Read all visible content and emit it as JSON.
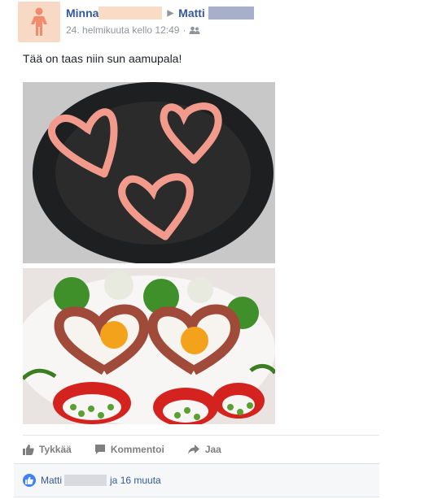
{
  "post": {
    "author": "Minna",
    "target": "Matti",
    "timestamp": "24. helmikuuta kello 12:49",
    "privacy_icon": "friends-icon",
    "text": "Tää on taas niin sun aamupala!"
  },
  "actions": {
    "like": "Tykkää",
    "comment": "Kommentoi",
    "share": "Jaa"
  },
  "likes": {
    "liker": "Matti",
    "rest": "ja 16 muuta"
  },
  "colors": {
    "link": "#365899",
    "like_badge": "#4080ff",
    "avatar_bg": "#f7d9c6"
  }
}
